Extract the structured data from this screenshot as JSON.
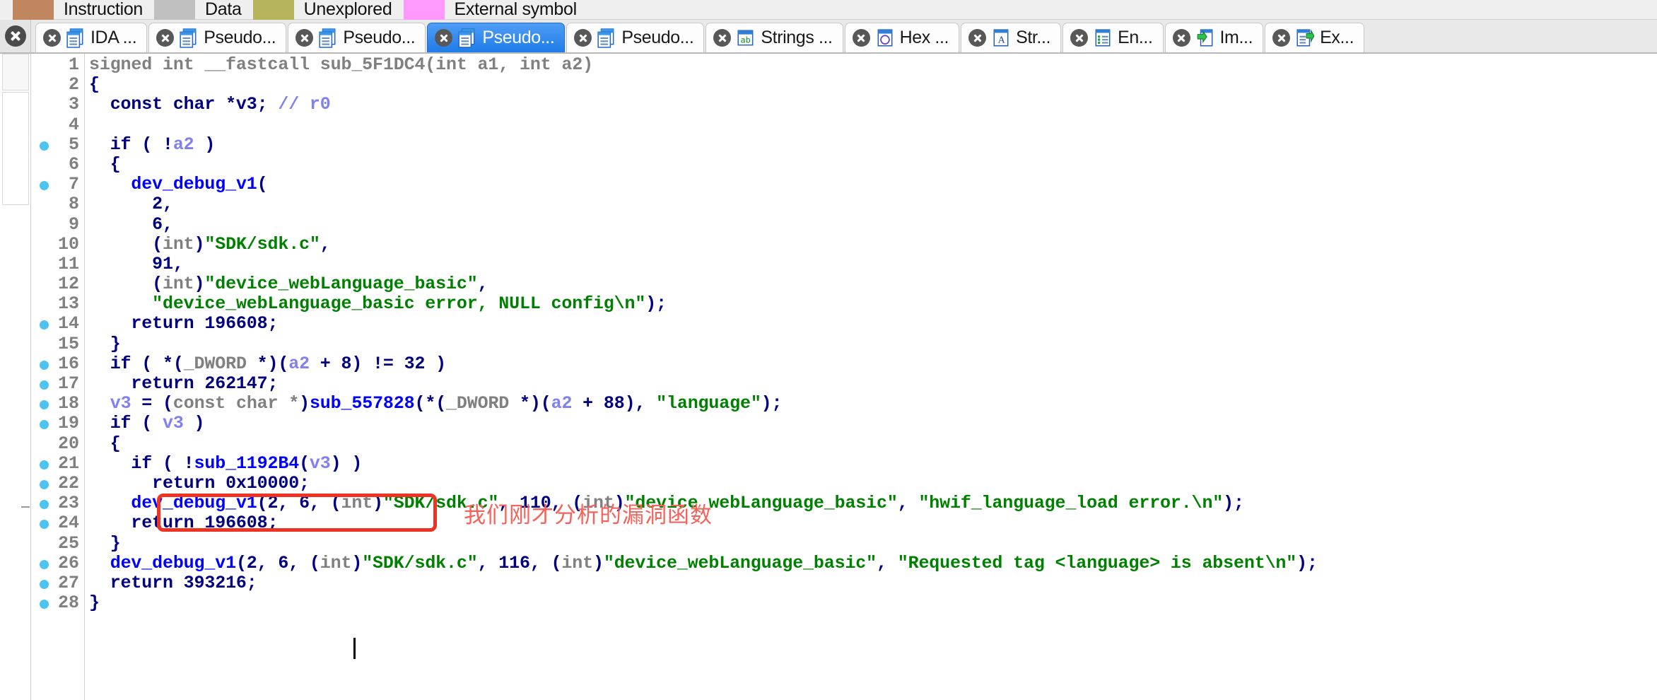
{
  "legend": {
    "items": [
      {
        "label": "Instruction",
        "color": "#c08660"
      },
      {
        "label": "Data",
        "color": "#c0c0c0"
      },
      {
        "label": "Unexplored",
        "color": "#b5b35c"
      },
      {
        "label": "External symbol",
        "color": "#ff99ff"
      }
    ]
  },
  "tabs": [
    {
      "label": "IDA ...",
      "icon": "pseudocode-doc-icon",
      "active": false
    },
    {
      "label": "Pseudo...",
      "icon": "pseudocode-doc-icon",
      "active": false
    },
    {
      "label": "Pseudo...",
      "icon": "pseudocode-doc-icon",
      "active": false
    },
    {
      "label": "Pseudo...",
      "icon": "pseudocode-doc-icon",
      "active": true
    },
    {
      "label": "Pseudo...",
      "icon": "pseudocode-doc-icon",
      "active": false
    },
    {
      "label": "Strings ...",
      "icon": "strings-icon",
      "active": false
    },
    {
      "label": "Hex ...",
      "icon": "hexview-icon",
      "active": false
    },
    {
      "label": "Str...",
      "icon": "structures-icon",
      "active": false
    },
    {
      "label": "En...",
      "icon": "enums-icon",
      "active": false
    },
    {
      "label": "Im...",
      "icon": "imports-icon",
      "active": false
    },
    {
      "label": "Ex...",
      "icon": "exports-icon",
      "active": false
    }
  ],
  "annotation": {
    "text": "我们刚才分析的漏洞函数",
    "box_color": "#ee3322",
    "text_color": "#f4625c"
  },
  "colors": {
    "keyword": "#000080",
    "function": "#0000ff",
    "string": "#008000",
    "number": "#000080",
    "variable": "#8080f0",
    "cast": "#808080",
    "comment": "#8080f0",
    "line_number": "#808080",
    "breakpoint_dot": "#4ec3f0",
    "active_tab": "#1f7ce8"
  },
  "code": {
    "function_name": "sub_5F1DC4",
    "lines": [
      {
        "n": 1,
        "dot": false,
        "tokens": [
          {
            "t": "signed int __fastcall ",
            "c": "gray"
          },
          {
            "t": "sub_5F1DC4",
            "c": "gray"
          },
          {
            "t": "(int a1, int a2)",
            "c": "gray"
          }
        ]
      },
      {
        "n": 2,
        "dot": false,
        "tokens": [
          {
            "t": "{",
            "c": "kw"
          }
        ]
      },
      {
        "n": 3,
        "dot": false,
        "tokens": [
          {
            "t": "  const char *v3; ",
            "c": "kw"
          },
          {
            "t": "// r0",
            "c": "cmt"
          }
        ]
      },
      {
        "n": 4,
        "dot": false,
        "tokens": [
          {
            "t": "",
            "c": "plain"
          }
        ]
      },
      {
        "n": 5,
        "dot": true,
        "tokens": [
          {
            "t": "  if ( !",
            "c": "kw"
          },
          {
            "t": "a2",
            "c": "var"
          },
          {
            "t": " )",
            "c": "kw"
          }
        ]
      },
      {
        "n": 6,
        "dot": false,
        "tokens": [
          {
            "t": "  {",
            "c": "kw"
          }
        ]
      },
      {
        "n": 7,
        "dot": true,
        "tokens": [
          {
            "t": "    ",
            "c": "plain"
          },
          {
            "t": "dev_debug_v1",
            "c": "fn"
          },
          {
            "t": "(",
            "c": "kw"
          }
        ]
      },
      {
        "n": 8,
        "dot": false,
        "tokens": [
          {
            "t": "      2,",
            "c": "num"
          }
        ]
      },
      {
        "n": 9,
        "dot": false,
        "tokens": [
          {
            "t": "      6,",
            "c": "num"
          }
        ]
      },
      {
        "n": 10,
        "dot": false,
        "tokens": [
          {
            "t": "      (",
            "c": "kw"
          },
          {
            "t": "int",
            "c": "cast"
          },
          {
            "t": ")",
            "c": "kw"
          },
          {
            "t": "\"SDK/sdk.c\"",
            "c": "str"
          },
          {
            "t": ",",
            "c": "kw"
          }
        ]
      },
      {
        "n": 11,
        "dot": false,
        "tokens": [
          {
            "t": "      91,",
            "c": "num"
          }
        ]
      },
      {
        "n": 12,
        "dot": false,
        "tokens": [
          {
            "t": "      (",
            "c": "kw"
          },
          {
            "t": "int",
            "c": "cast"
          },
          {
            "t": ")",
            "c": "kw"
          },
          {
            "t": "\"device_webLanguage_basic\"",
            "c": "str"
          },
          {
            "t": ",",
            "c": "kw"
          }
        ]
      },
      {
        "n": 13,
        "dot": false,
        "tokens": [
          {
            "t": "      ",
            "c": "plain"
          },
          {
            "t": "\"device_webLanguage_basic error, NULL config\\n\"",
            "c": "str"
          },
          {
            "t": ");",
            "c": "kw"
          }
        ]
      },
      {
        "n": 14,
        "dot": true,
        "tokens": [
          {
            "t": "    return 196608;",
            "c": "kw"
          }
        ]
      },
      {
        "n": 15,
        "dot": false,
        "tokens": [
          {
            "t": "  }",
            "c": "kw"
          }
        ]
      },
      {
        "n": 16,
        "dot": true,
        "tokens": [
          {
            "t": "  if ( *(",
            "c": "kw"
          },
          {
            "t": "_DWORD",
            "c": "cast"
          },
          {
            "t": " *)(",
            "c": "kw"
          },
          {
            "t": "a2",
            "c": "var"
          },
          {
            "t": " + 8) != 32 )",
            "c": "kw"
          }
        ]
      },
      {
        "n": 17,
        "dot": true,
        "tokens": [
          {
            "t": "    return 262147;",
            "c": "kw"
          }
        ]
      },
      {
        "n": 18,
        "dot": true,
        "tokens": [
          {
            "t": "  ",
            "c": "plain"
          },
          {
            "t": "v3",
            "c": "var"
          },
          {
            "t": " = (",
            "c": "kw"
          },
          {
            "t": "const char *",
            "c": "cast"
          },
          {
            "t": ")",
            "c": "kw"
          },
          {
            "t": "sub_557828",
            "c": "fn"
          },
          {
            "t": "(*(",
            "c": "kw"
          },
          {
            "t": "_DWORD",
            "c": "cast"
          },
          {
            "t": " *)(",
            "c": "kw"
          },
          {
            "t": "a2",
            "c": "var"
          },
          {
            "t": " + 88), ",
            "c": "kw"
          },
          {
            "t": "\"language\"",
            "c": "str"
          },
          {
            "t": ");",
            "c": "kw"
          }
        ]
      },
      {
        "n": 19,
        "dot": true,
        "tokens": [
          {
            "t": "  if ( ",
            "c": "kw"
          },
          {
            "t": "v3",
            "c": "var"
          },
          {
            "t": " )",
            "c": "kw"
          }
        ]
      },
      {
        "n": 20,
        "dot": false,
        "tokens": [
          {
            "t": "  {",
            "c": "kw"
          }
        ]
      },
      {
        "n": 21,
        "dot": true,
        "tokens": [
          {
            "t": "    if ( !",
            "c": "kw"
          },
          {
            "t": "sub_1192B4",
            "c": "fn"
          },
          {
            "t": "(",
            "c": "kw"
          },
          {
            "t": "v3",
            "c": "var"
          },
          {
            "t": ") )",
            "c": "kw"
          }
        ]
      },
      {
        "n": 22,
        "dot": true,
        "tokens": [
          {
            "t": "      return 0x10000;",
            "c": "kw"
          }
        ]
      },
      {
        "n": 23,
        "dot": true,
        "tokens": [
          {
            "t": "    ",
            "c": "plain"
          },
          {
            "t": "dev_debug_v1",
            "c": "fn"
          },
          {
            "t": "(2, 6, (",
            "c": "kw"
          },
          {
            "t": "int",
            "c": "cast"
          },
          {
            "t": ")",
            "c": "kw"
          },
          {
            "t": "\"SDK/sdk.c\"",
            "c": "str"
          },
          {
            "t": ", 110, (",
            "c": "kw"
          },
          {
            "t": "int",
            "c": "cast"
          },
          {
            "t": ")",
            "c": "kw"
          },
          {
            "t": "\"device_webLanguage_basic\"",
            "c": "str"
          },
          {
            "t": ", ",
            "c": "kw"
          },
          {
            "t": "\"hwif_language_load error.\\n\"",
            "c": "str"
          },
          {
            "t": ");",
            "c": "kw"
          }
        ]
      },
      {
        "n": 24,
        "dot": true,
        "tokens": [
          {
            "t": "    return 196608;",
            "c": "kw"
          }
        ]
      },
      {
        "n": 25,
        "dot": false,
        "tokens": [
          {
            "t": "  }",
            "c": "kw"
          }
        ]
      },
      {
        "n": 26,
        "dot": true,
        "tokens": [
          {
            "t": "  ",
            "c": "plain"
          },
          {
            "t": "dev_debug_v1",
            "c": "fn"
          },
          {
            "t": "(2, 6, (",
            "c": "kw"
          },
          {
            "t": "int",
            "c": "cast"
          },
          {
            "t": ")",
            "c": "kw"
          },
          {
            "t": "\"SDK/sdk.c\"",
            "c": "str"
          },
          {
            "t": ", 116, (",
            "c": "kw"
          },
          {
            "t": "int",
            "c": "cast"
          },
          {
            "t": ")",
            "c": "kw"
          },
          {
            "t": "\"device_webLanguage_basic\"",
            "c": "str"
          },
          {
            "t": ", ",
            "c": "kw"
          },
          {
            "t": "\"Requested tag <language> is absent\\n\"",
            "c": "str"
          },
          {
            "t": ");",
            "c": "kw"
          }
        ]
      },
      {
        "n": 27,
        "dot": true,
        "tokens": [
          {
            "t": "  return 393216;",
            "c": "kw"
          }
        ]
      },
      {
        "n": 28,
        "dot": true,
        "tokens": [
          {
            "t": "}",
            "c": "kw"
          }
        ]
      }
    ]
  }
}
